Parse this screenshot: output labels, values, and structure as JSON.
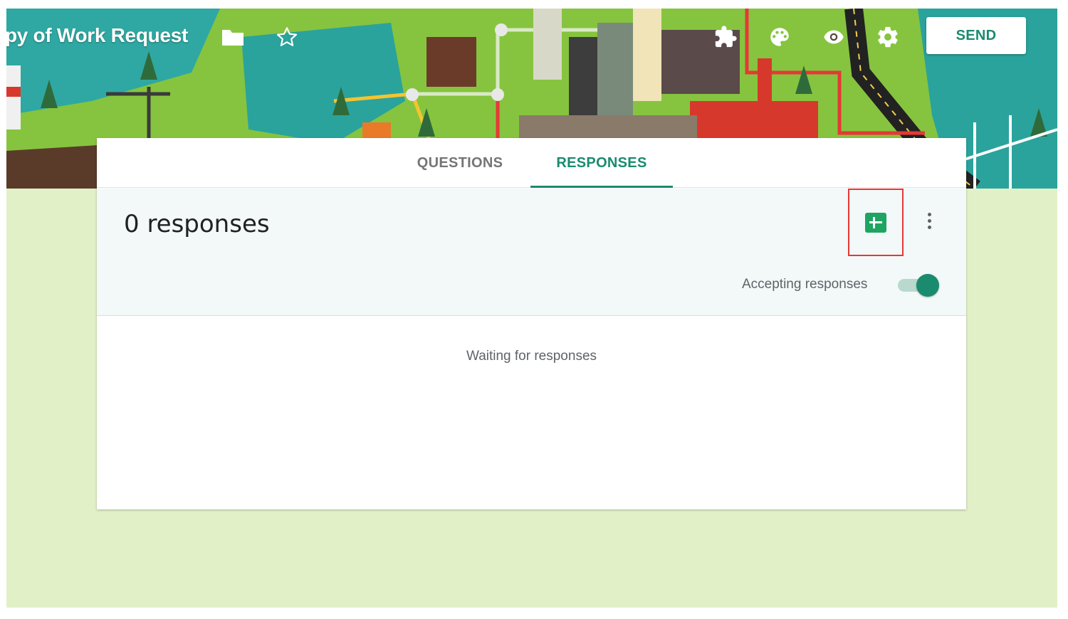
{
  "header": {
    "title": "py of Work Request",
    "icons": [
      {
        "name": "folder-icon"
      },
      {
        "name": "star-icon"
      },
      {
        "name": "addons-icon"
      },
      {
        "name": "palette-icon"
      },
      {
        "name": "preview-icon"
      },
      {
        "name": "settings-icon"
      }
    ],
    "send_label": "SEND"
  },
  "tabs": {
    "questions": "QUESTIONS",
    "responses": "RESPONSES",
    "active": "responses"
  },
  "summary": {
    "count_text": "0 responses",
    "accepting_label": "Accepting responses",
    "accepting_on": true
  },
  "empty_state": "Waiting for responses",
  "colors": {
    "accent": "#1a8b6f",
    "sheets": "#1fa463",
    "highlight_box": "#e53935",
    "page_bg": "#e2f0c8"
  }
}
